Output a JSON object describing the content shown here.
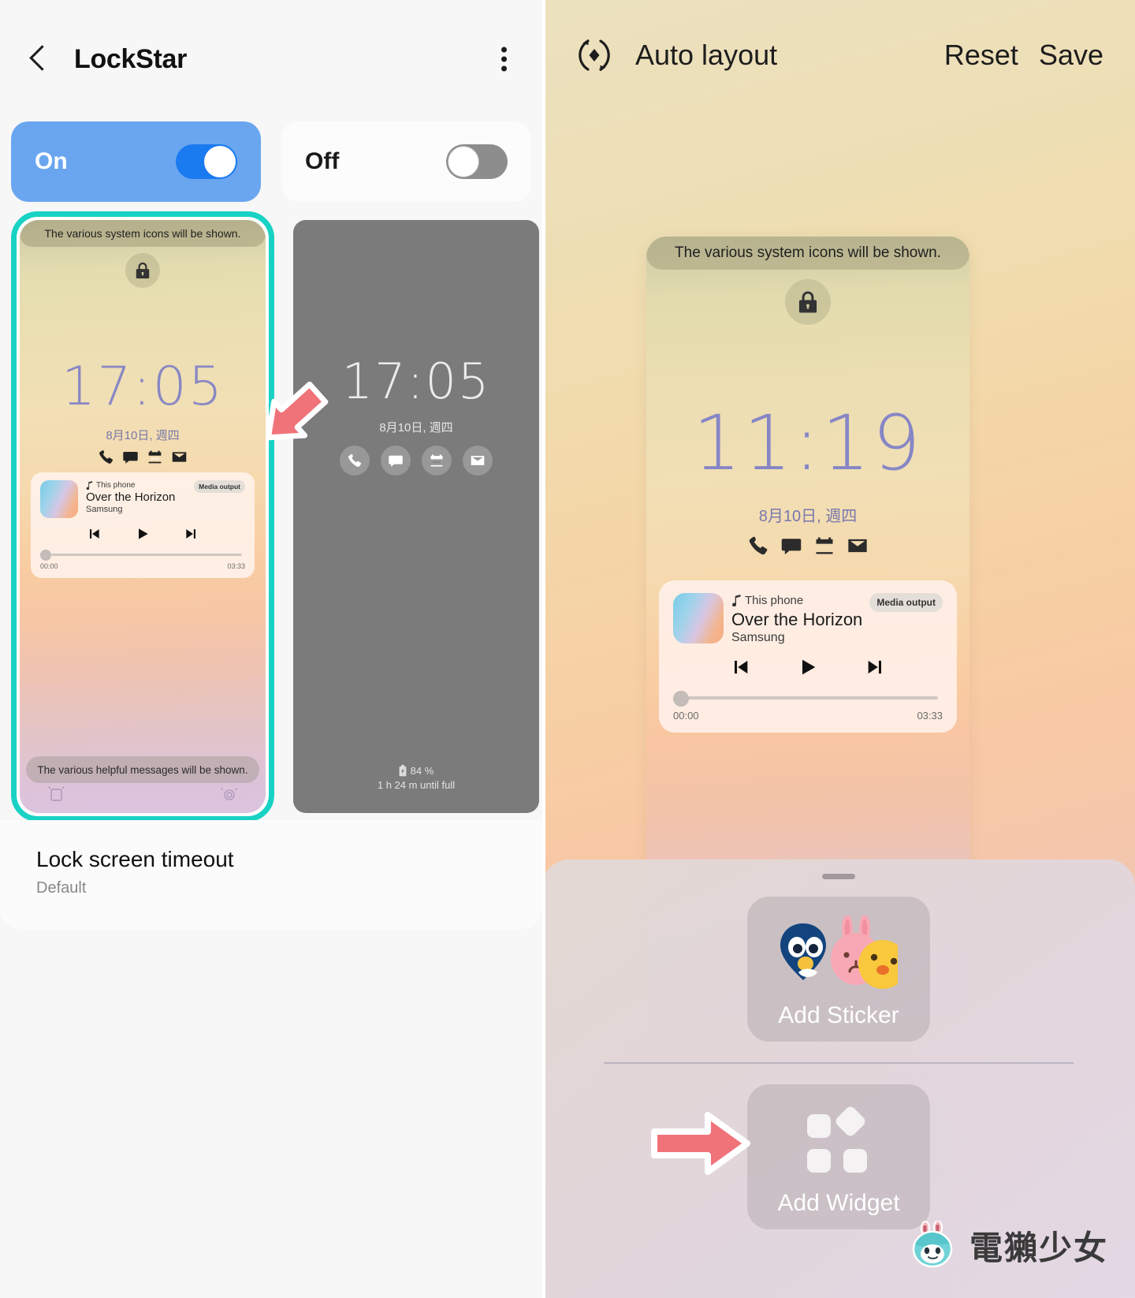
{
  "left": {
    "header": {
      "title": "LockStar",
      "back_icon": "back-chevron-icon",
      "menu_icon": "kebab-menu-icon"
    },
    "toggles": [
      {
        "label": "On",
        "state": "on",
        "selected": true
      },
      {
        "label": "Off",
        "state": "off",
        "selected": false
      }
    ],
    "preview_on": {
      "system_icons_text": "The various system icons will be shown.",
      "lock_icon": "lock-icon",
      "time": "17:05",
      "date": "8月10日, 週四",
      "shortcut_icons": [
        "phone-icon",
        "message-icon",
        "calendar-icon",
        "mail-icon"
      ],
      "media": {
        "source": "This phone",
        "title": "Over the Horizon",
        "artist": "Samsung",
        "output_label": "Media output",
        "elapsed": "00:00",
        "duration": "03:33",
        "controls": [
          "previous-icon",
          "play-icon",
          "next-icon"
        ]
      },
      "helpful_text": "The various helpful messages will be shown.",
      "bottom_shortcuts": [
        "camera-icon",
        "record-icon"
      ]
    },
    "preview_off": {
      "time": "17:05",
      "date": "8月10日, 週四",
      "shortcut_icons": [
        "phone-icon",
        "message-icon",
        "calendar-icon",
        "mail-icon"
      ],
      "battery_percent": "84 %",
      "battery_status": "1 h 24 m until full"
    },
    "setting": {
      "title": "Lock screen timeout",
      "value": "Default"
    },
    "annotation": {
      "arrow": "red-arrow-pointing-to-on-toggle"
    }
  },
  "right": {
    "header": {
      "auto_layout_label": "Auto layout",
      "auto_layout_icon": "auto-layout-icon",
      "reset_label": "Reset",
      "save_label": "Save"
    },
    "preview": {
      "system_icons_text": "The various system icons will be shown.",
      "lock_icon": "lock-icon",
      "time": "11:19",
      "date": "8月10日, 週四",
      "shortcut_icons": [
        "phone-icon",
        "message-icon",
        "calendar-icon",
        "mail-icon"
      ],
      "media": {
        "source": "This phone",
        "title": "Over the Horizon",
        "artist": "Samsung",
        "output_label": "Media output",
        "elapsed": "00:00",
        "duration": "03:33",
        "controls": [
          "previous-icon",
          "play-icon",
          "next-icon"
        ]
      }
    },
    "sheet": {
      "add_sticker_label": "Add Sticker",
      "add_sticker_icon": "sticker-characters-icon",
      "add_widget_label": "Add Widget",
      "add_widget_icon": "widget-grid-icon",
      "annotation": {
        "arrow": "red-arrow-pointing-to-add-widget"
      }
    },
    "watermark": {
      "text": "電獺少女",
      "mascot": "otter-mascot-icon"
    }
  },
  "colors": {
    "accent_teal": "#18d2c4",
    "toggle_on_card": "#6aa6f0",
    "switch_on": "#1a7af0",
    "switch_off": "#8d8d8d",
    "arrow_red": "#f0737a",
    "clock_purple": "#8686c6"
  }
}
